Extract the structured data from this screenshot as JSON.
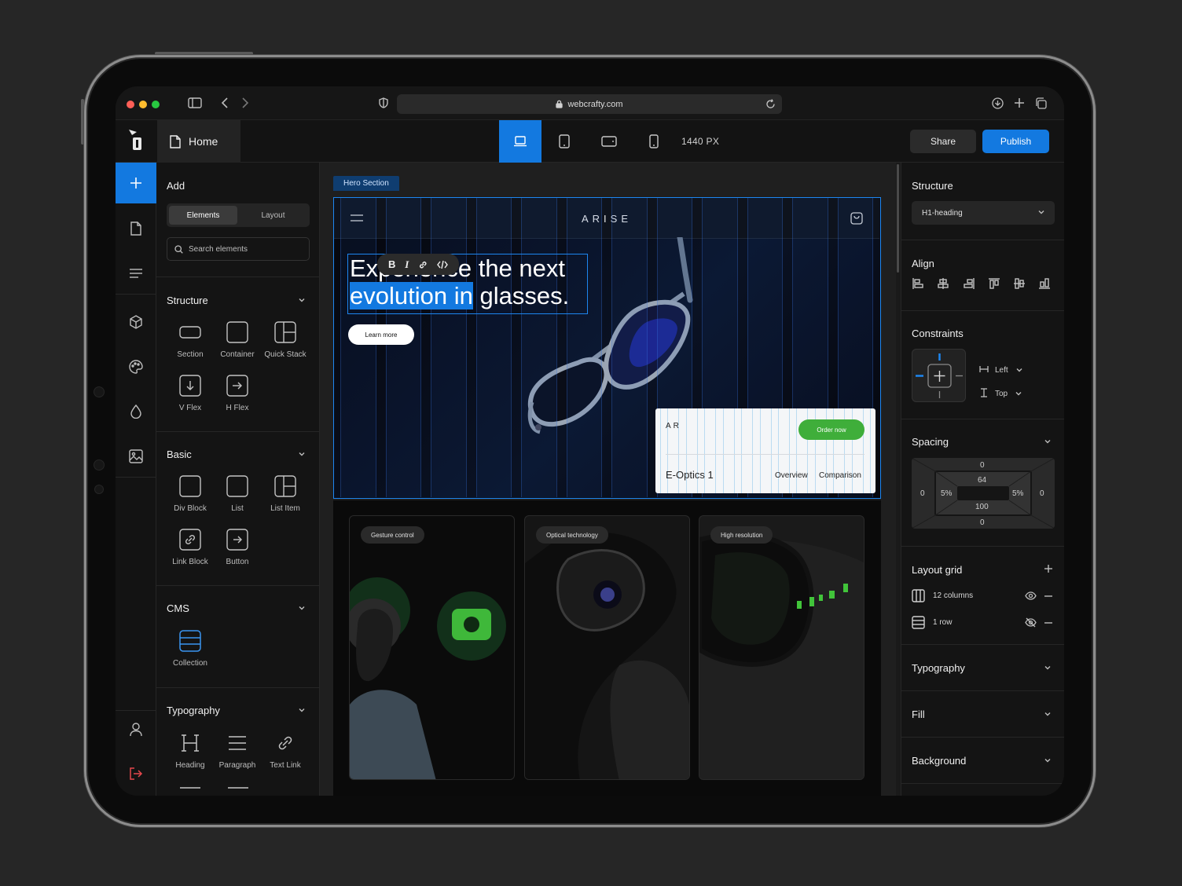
{
  "browser": {
    "url": "webcrafty.com"
  },
  "header": {
    "page_tab": "Home",
    "viewport_width": "1440 PX",
    "share_label": "Share",
    "publish_label": "Publish",
    "active_device": "desktop"
  },
  "add_panel": {
    "title": "Add",
    "tabs": [
      "Elements",
      "Layout"
    ],
    "search_placeholder": "Search elements",
    "sections": [
      {
        "title": "Structure",
        "items": [
          "Section",
          "Container",
          "Quick Stack",
          "V Flex",
          "H Flex"
        ]
      },
      {
        "title": "Basic",
        "items": [
          "Div Block",
          "List",
          "List Item",
          "Link Block",
          "Button"
        ]
      },
      {
        "title": "CMS",
        "items": [
          "Collection"
        ]
      },
      {
        "title": "Typography",
        "items": [
          "Heading",
          "Paragraph",
          "Text Link"
        ]
      }
    ]
  },
  "canvas": {
    "section_tag": "Hero Section",
    "brand": "ARISE",
    "headline_line1": "Experience the next",
    "headline_line2_selected": "evolution in",
    "headline_line2_rest": " glasses.",
    "cta": "Learn more",
    "card": {
      "brand": "AR",
      "order": "Order now",
      "product": "E-Optics 1",
      "link_overview": "Overview",
      "link_comparison": "Comparison"
    },
    "features": [
      "Gesture control",
      "Optical  technology",
      "High resolution"
    ]
  },
  "properties": {
    "structure_title": "Structure",
    "structure_value": "H1-heading",
    "align_title": "Align",
    "constraints_title": "Constraints",
    "constraint_h": "Left",
    "constraint_v": "Top",
    "spacing_title": "Spacing",
    "spacing": {
      "margin_top": "0",
      "margin_bottom": "0",
      "margin_left": "0",
      "margin_right": "0",
      "padding_top": "64",
      "padding_bottom": "100",
      "padding_left": "5%",
      "padding_right": "5%"
    },
    "layout_grid_title": "Layout grid",
    "grid_columns": "12 columns",
    "grid_rows": "1 row",
    "typography_title": "Typography",
    "fill_title": "Fill",
    "background_title": "Background"
  },
  "colors": {
    "accent": "#1379e0",
    "order_green": "#3fae3a",
    "logout_red": "#e5484d"
  }
}
